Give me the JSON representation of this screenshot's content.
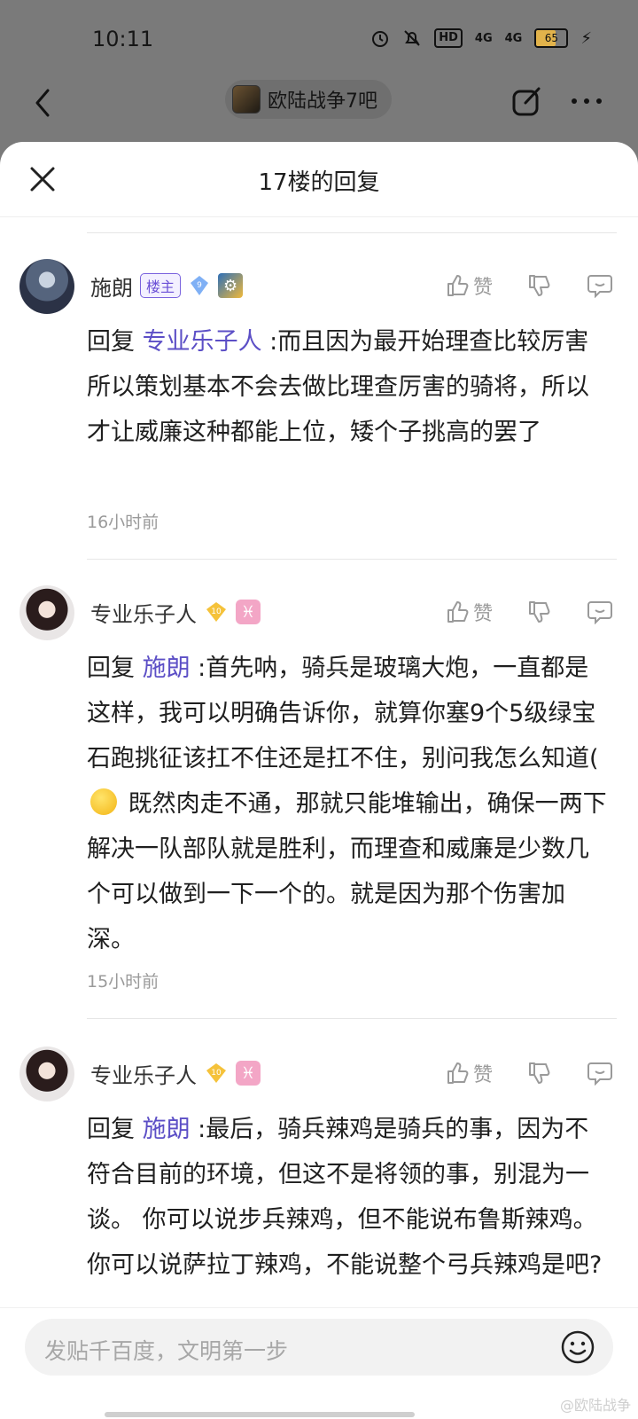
{
  "status_bar": {
    "time": "10:11",
    "hd": "HD",
    "net1": "4G",
    "net2": "4G",
    "battery": "65"
  },
  "top_nav": {
    "forum_name": "欧陆战争7吧"
  },
  "sheet": {
    "title": "17楼的回复"
  },
  "comments": [
    {
      "name": "施朗",
      "owner_tag": "楼主",
      "level": "9",
      "like_label": "赞",
      "reply_prefix": "回复",
      "mention": "专业乐子人",
      "text": " :而且因为最开始理查比较厉害 所以策划基本不会去做比理查厉害的骑将，所以才让威廉这种都能上位，矮个子挑高的罢了",
      "time": "16小时前"
    },
    {
      "name": "专业乐子人",
      "level": "10",
      "zodiac": "♓",
      "like_label": "赞",
      "reply_prefix": "回复",
      "mention": "施朗",
      "text_before_emoji": " :首先呐，骑兵是玻璃大炮，一直都是这样，我可以明确告诉你，就算你塞9个5级绿宝石跑挑征该扛不住还是扛不住，别问我怎么知道(",
      "text_after_emoji": " 既然肉走不通，那就只能堆输出，确保一两下解决一队部队就是胜利，而理查和威廉是少数几个可以做到一下一个的。就是因为那个伤害加深。",
      "time": "15小时前"
    },
    {
      "name": "专业乐子人",
      "level": "10",
      "zodiac": "♓",
      "like_label": "赞",
      "reply_prefix": "回复",
      "mention": "施朗",
      "text": " :最后，骑兵辣鸡是骑兵的事，因为不符合目前的环境，但这不是将领的事，别混为一谈。 你可以说步兵辣鸡，但不能说布鲁斯辣鸡。 你可以说萨拉丁辣鸡，不能说整个弓兵辣鸡是吧?"
    }
  ],
  "bottom_bar": {
    "placeholder": "发贴千百度，文明第一步",
    "watermark": "@欧陆战争"
  },
  "colors": {
    "accent": "#5c4fc6",
    "overlay": "#7a7a7a"
  }
}
